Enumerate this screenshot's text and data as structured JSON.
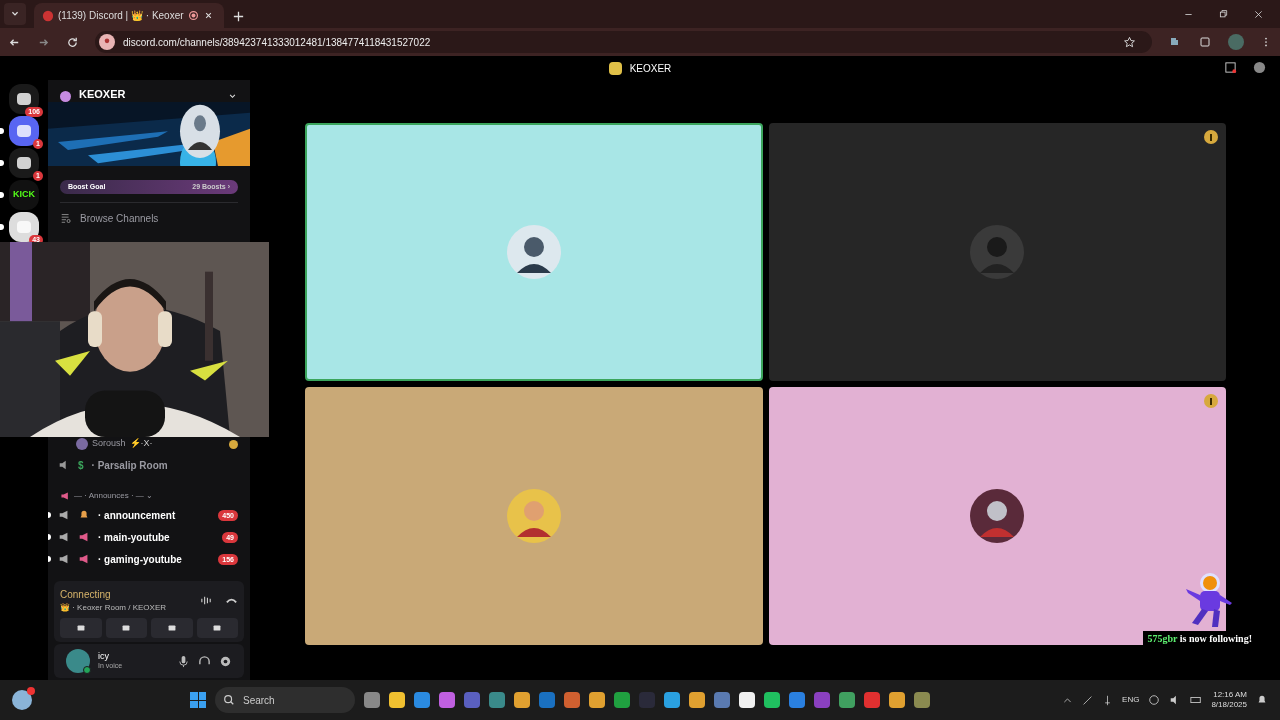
{
  "browser": {
    "tab_title": "(1139) Discord | 👑 · Keoxer",
    "url": "discord.com/channels/389423741333012481/1384774118431527022"
  },
  "header": {
    "title": "KEOXER"
  },
  "servers": [
    {
      "badge": "106",
      "unread": false
    },
    {
      "badge": "1",
      "unread": true
    },
    {
      "badge": "1",
      "unread": true
    },
    {
      "label": "KICK",
      "unread": true
    },
    {
      "badge": "43",
      "unread": true
    }
  ],
  "server": {
    "name": "KEOXER",
    "boost_goal": "Boost Goal",
    "boosts": "29 Boosts ›",
    "browse": "Browse Channels"
  },
  "voice_member": {
    "name": "Soroush",
    "tag": "⚡·X·"
  },
  "voice_channel": {
    "prefix": "$",
    "name": "· Parsalip Room"
  },
  "category": {
    "name": "— · Announces · — ⌄"
  },
  "channels": [
    {
      "name": "· announcement",
      "badge": "450",
      "unread": true
    },
    {
      "name": "· main-youtube",
      "badge": "49",
      "unread": true
    },
    {
      "name": "· gaming-youtube",
      "badge": "156",
      "unread": true
    }
  ],
  "voice_panel": {
    "status": "Connecting",
    "room": "👑 · Keoxer Room / KEOXER"
  },
  "user": {
    "name": "icy",
    "status": "In voice"
  },
  "tiles": [
    {
      "color": "#a8e6e6",
      "speaking": true,
      "warning": false
    },
    {
      "color": "#262626",
      "speaking": false,
      "warning": true
    },
    {
      "color": "#c9a977",
      "speaking": false,
      "warning": false
    },
    {
      "color": "#e2b1d3",
      "speaking": false,
      "warning": true
    }
  ],
  "alert": {
    "user": "575gbr",
    "text": "is now following!"
  },
  "taskbar": {
    "search": "Search",
    "language": "ENG",
    "time": "12:16 AM",
    "date": "8/18/2025"
  }
}
